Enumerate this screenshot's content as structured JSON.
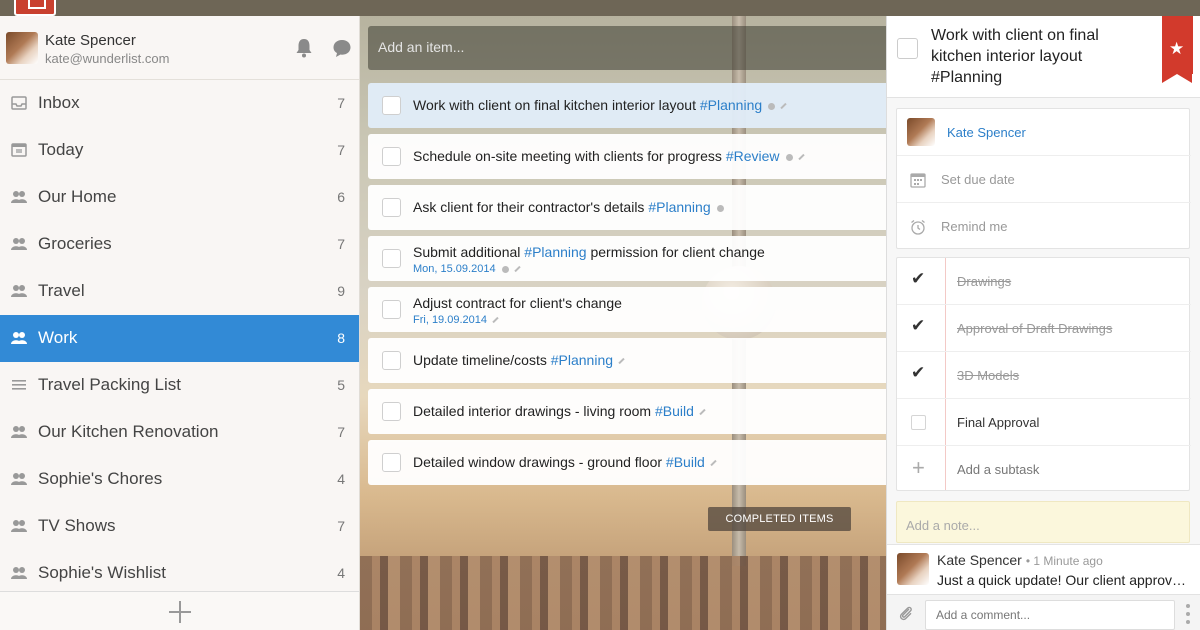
{
  "colors": {
    "accent": "#328ad6",
    "tag": "#2c7fc9",
    "ribbon": "#d23a2c"
  },
  "user": {
    "name": "Kate Spencer",
    "email": "kate@wunderlist.com"
  },
  "sidebar": {
    "items": [
      {
        "label": "Inbox",
        "count": "7",
        "icon": "inbox-icon"
      },
      {
        "label": "Today",
        "count": "7",
        "icon": "calendar-icon"
      },
      {
        "label": "Our Home",
        "count": "6",
        "icon": "shared-users-icon"
      },
      {
        "label": "Groceries",
        "count": "7",
        "icon": "shared-users-icon"
      },
      {
        "label": "Travel",
        "count": "9",
        "icon": "shared-users-icon"
      },
      {
        "label": "Work",
        "count": "8",
        "icon": "shared-users-icon"
      },
      {
        "label": "Travel Packing List",
        "count": "5",
        "icon": "list-icon"
      },
      {
        "label": "Our Kitchen Renovation",
        "count": "7",
        "icon": "shared-users-icon"
      },
      {
        "label": "Sophie's Chores",
        "count": "4",
        "icon": "shared-users-icon"
      },
      {
        "label": "TV Shows",
        "count": "7",
        "icon": "shared-users-icon"
      },
      {
        "label": "Sophie's Wishlist",
        "count": "4",
        "icon": "shared-users-icon"
      }
    ]
  },
  "main": {
    "add_item_placeholder": "Add an item...",
    "completed_label": "COMPLETED ITEMS",
    "tasks": [
      {
        "text": "Work with client on final kitchen interior layout",
        "tag": "#Planning",
        "date": ""
      },
      {
        "text": "Schedule on-site meeting with clients for progress",
        "tag": "#Review",
        "date": ""
      },
      {
        "text": "Ask client for their contractor's details",
        "tag": "#Planning",
        "date": ""
      },
      {
        "text_before": "Submit additional",
        "tag": "#Planning",
        "text_after": "permission for client change",
        "date": "Mon, 15.09.2014"
      },
      {
        "text": "Adjust contract for client's change",
        "tag": "",
        "date": "Fri, 19.09.2014"
      },
      {
        "text": "Update timeline/costs",
        "tag": "#Planning",
        "date": ""
      },
      {
        "text": "Detailed interior drawings - living room",
        "tag": "#Build",
        "date": ""
      },
      {
        "text": "Detailed window drawings - ground floor",
        "tag": "#Build",
        "date": ""
      }
    ]
  },
  "detail": {
    "title": "Work with client on final kitchen interior layout #Planning",
    "assignee": "Kate Spencer",
    "due_date_label": "Set due date",
    "remind_label": "Remind me",
    "subtasks": [
      {
        "label": "Drawings",
        "done": true
      },
      {
        "label": "Approval of Draft Drawings",
        "done": true
      },
      {
        "label": "3D Models",
        "done": true
      },
      {
        "label": "Final Approval",
        "done": false
      }
    ],
    "add_subtask_label": "Add a subtask",
    "note_placeholder": "Add a note...",
    "comment": {
      "author": "Kate Spencer",
      "time": "• 1 Minute ago",
      "text": "Just a quick update! Our client approved the layout"
    },
    "comment_placeholder": "Add a comment..."
  }
}
